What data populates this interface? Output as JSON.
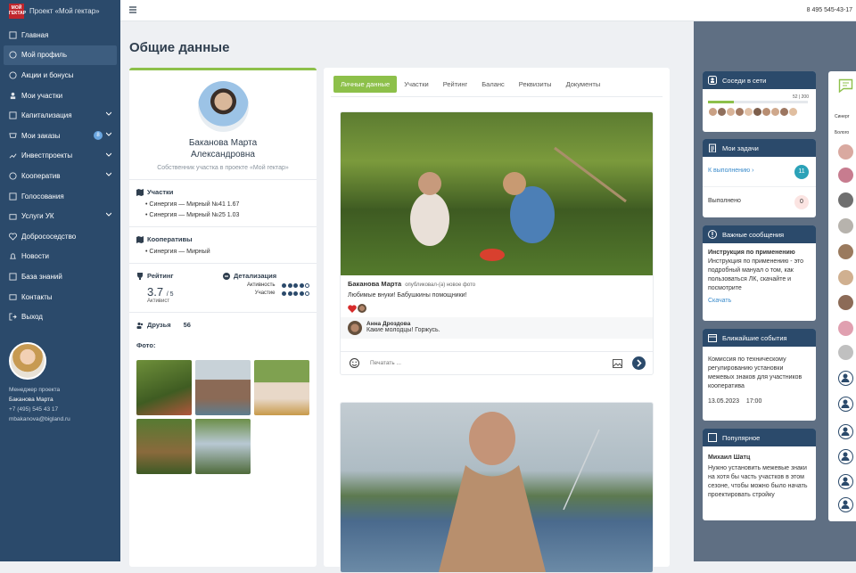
{
  "brand": {
    "logo_text": "МОЙ ГЕКТАР",
    "project": "Проект «Мой гектар»"
  },
  "topbar": {
    "phone": "8 495 545-43-17"
  },
  "sidebar": {
    "items": [
      {
        "label": "Главная"
      },
      {
        "label": "Мой профиль"
      },
      {
        "label": "Акции и бонусы"
      },
      {
        "label": "Мои участки"
      },
      {
        "label": "Капитализация"
      },
      {
        "label": "Мои заказы",
        "badge": "8"
      },
      {
        "label": "Инвестпроекты"
      },
      {
        "label": "Кооператив"
      },
      {
        "label": "Голосования"
      },
      {
        "label": "Услуги УК"
      },
      {
        "label": "Добрососедство"
      },
      {
        "label": "Новости"
      },
      {
        "label": "База знаний"
      },
      {
        "label": "Контакты"
      },
      {
        "label": "Выход"
      }
    ],
    "manager": {
      "title": "Менеджер проекта",
      "name": "Баканова Марта",
      "phone": "+7 (495) 545 43 17",
      "email": "mbakanova@bigland.ru"
    }
  },
  "page_title": "Общие данные",
  "profile": {
    "name_line1": "Баканова Марта",
    "name_line2": "Александровна",
    "role": "Собственник участка в проекте «Мой гектар»",
    "plots_title": "Участки",
    "plots": [
      "Синергия — Мирный №41 1.67",
      "Синергия — Мирный №25 1.03"
    ],
    "coops_title": "Кооперативы",
    "coops": [
      "Синергия — Мирный"
    ],
    "rating_title": "Рейтинг",
    "rating_value": "3.7",
    "rating_max": "/ 5",
    "rating_label": "Активист",
    "detail_title": "Детализация",
    "detail_activity": "Активность",
    "detail_participation": "Участие",
    "activity_level": 4,
    "participation_level": 4,
    "friends_label": "Друзья",
    "friends_count": "56",
    "photos_label": "Фото:"
  },
  "tabs": [
    "Личные данные",
    "Участки",
    "Рейтинг",
    "Баланс",
    "Реквизиты",
    "Документы"
  ],
  "post": {
    "author": "Баканова Марта",
    "action": "опубликовал-(а) новое фото",
    "text": "Любимые внуки! Бабушкины помощники!",
    "comment_author": "Анна Дроздова",
    "comment_text": "Какие молодцы! Горжусь.",
    "composer_placeholder": "Печатать ..."
  },
  "right": {
    "neighbors": {
      "title": "Соседи в сети",
      "count": "52",
      "total": "200"
    },
    "tasks": {
      "title": "Мои задачи",
      "todo_label": "К выполнению",
      "todo_count": "11",
      "done_label": "Выполнено",
      "done_count": "0"
    },
    "messages": {
      "title": "Важные сообщения",
      "subject": "Инструкция по применению",
      "body": "Инструкция по применению - это подробный мануал о том, как пользоваться ЛК, скачайте и посмотрите",
      "link": "Скачать"
    },
    "events": {
      "title": "Ближайшие события",
      "body": "Комиссия по техническому регулированию установки межевых знаков для участников кооператива",
      "date": "13.05.2023",
      "time": "17:00"
    },
    "popular": {
      "title": "Популярное",
      "author": "Михаил Шатц",
      "body": "Нужно установить межевые знаки на хотя бы часть участков в этом сезоне, чтобы можно было начать проектировать стройку"
    }
  },
  "side_column": {
    "label1": "Синерг",
    "label2": "Болого"
  }
}
